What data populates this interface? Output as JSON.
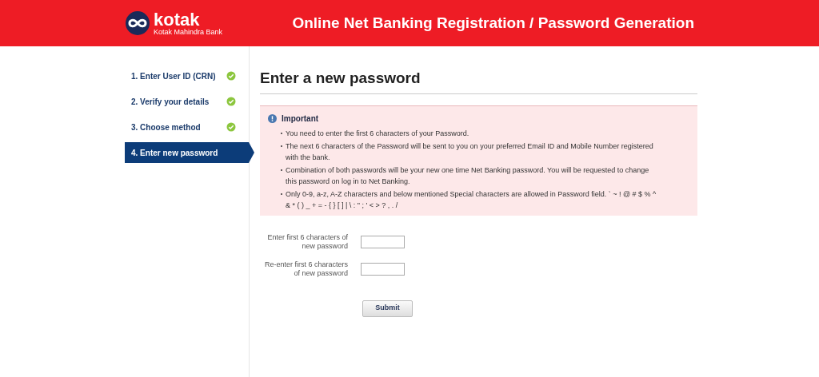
{
  "header": {
    "logo_name": "kotak",
    "logo_subtitle": "Kotak Mahindra Bank",
    "title": "Online Net Banking Registration / Password Generation"
  },
  "steps": [
    {
      "label": "1. Enter User ID (CRN)",
      "completed": true,
      "selected": false
    },
    {
      "label": "2. Verify your details",
      "completed": true,
      "selected": false
    },
    {
      "label": "3. Choose method",
      "completed": true,
      "selected": false
    },
    {
      "label": "4. Enter new password",
      "completed": false,
      "selected": true
    }
  ],
  "heading": "Enter a new password",
  "notice": {
    "title": "Important",
    "items": [
      "You need to enter the first 6 characters of your Password.",
      "The next 6 characters of the Password will be sent to you on your preferred Email ID and Mobile Number registered with the bank.",
      "Combination of both passwords will be your new one time Net Banking password. You will be requested to change this password on log in to Net Banking.",
      "Only 0-9, a-z, A-Z characters and below mentioned Special characters are allowed in Password field. ` ~ ! @ # $ % ^ & * ( ) _ + = - { } [ ] | \\ : \" ; ' < > ? , . /"
    ]
  },
  "fields": [
    {
      "label": "Enter first 6 characters of new password"
    },
    {
      "label": "Re-enter first 6 characters of new password"
    }
  ],
  "submit": "Submit"
}
